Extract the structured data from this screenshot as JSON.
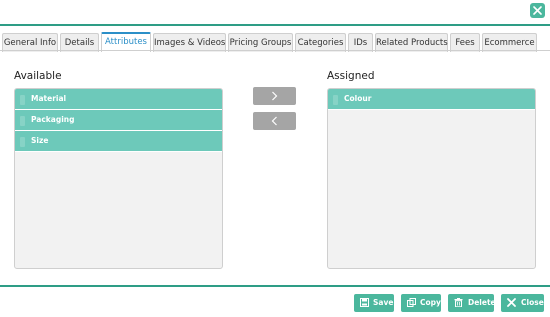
{
  "window": {
    "close_icon": "close-icon"
  },
  "tabs": [
    {
      "label": "General Info",
      "active": false
    },
    {
      "label": "Details",
      "active": false
    },
    {
      "label": "Attributes",
      "active": true
    },
    {
      "label": "Images & Videos",
      "active": false
    },
    {
      "label": "Pricing Groups",
      "active": false
    },
    {
      "label": "Categories",
      "active": false
    },
    {
      "label": "IDs",
      "active": false
    },
    {
      "label": "Related Products",
      "active": false
    },
    {
      "label": "Fees",
      "active": false
    },
    {
      "label": "Ecommerce",
      "active": false
    }
  ],
  "available": {
    "title": "Available",
    "items": [
      "Material",
      "Packaging",
      "Size"
    ]
  },
  "assigned": {
    "title": "Assigned",
    "items": [
      "Colour"
    ]
  },
  "transfer": {
    "add_icon": "chevron-right-icon",
    "remove_icon": "chevron-left-icon"
  },
  "footer": {
    "save": "Save",
    "copy": "Copy",
    "delete": "Delete",
    "close": "Close"
  },
  "colors": {
    "accent": "#4bb79d",
    "row": "#6dc9ba",
    "active_tab": "#2b8fc8"
  }
}
